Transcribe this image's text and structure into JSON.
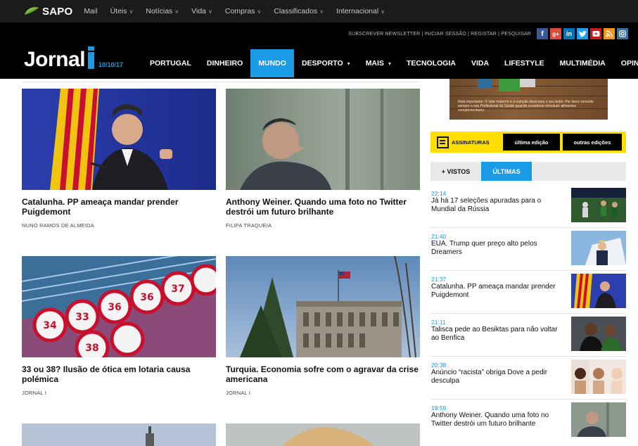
{
  "sapo_bar": {
    "logo": "SAPO",
    "links": [
      "Mail",
      "Úteis",
      "Notícias",
      "Vida",
      "Compras",
      "Classificados",
      "Internacional"
    ],
    "dropdown_links": [
      false,
      true,
      true,
      true,
      true,
      true,
      true
    ]
  },
  "header": {
    "util_links": "SUBSCREVER NEWSLETTER | INICIAR SESSÃO | REGISTAR | PESQUISAR",
    "logo_word": "Jornal",
    "date": "10/10/17",
    "social": [
      {
        "name": "facebook-icon",
        "glyph": "f",
        "color": "#3b5998"
      },
      {
        "name": "google-plus-icon",
        "glyph": "g+",
        "color": "#dd4b39"
      },
      {
        "name": "linkedin-icon",
        "glyph": "in",
        "color": "#0077b5"
      },
      {
        "name": "twitter-icon",
        "glyph": "t",
        "color": "#1da1f2"
      },
      {
        "name": "youtube-icon",
        "glyph": "▶",
        "color": "#cc181e"
      },
      {
        "name": "rss-icon",
        "glyph": "◉",
        "color": "#f7941d"
      },
      {
        "name": "instagram-icon",
        "glyph": "◎",
        "color": "#3f729b"
      }
    ]
  },
  "nav": {
    "items": [
      "PORTUGAL",
      "DINHEIRO",
      "MUNDO",
      "DESPORTO",
      "MAIS",
      "TECNOLOGIA",
      "VIDA",
      "LIFESTYLE",
      "MULTIMÉDIA",
      "OPINIÃO"
    ],
    "active_index": 2,
    "dropdown_items": [
      3,
      4
    ]
  },
  "articles": [
    {
      "title": "Catalunha. PP ameaça mandar prender Puigdemont",
      "author": "NUNO RAMOS DE ALMEIDA"
    },
    {
      "title": "Anthony Weiner. Quando uma foto no Twitter destrói um futuro brilhante",
      "author": "FILIPA TRAQUEIA"
    },
    {
      "title": "33 ou 38? Ilusão de ótica em lotaria causa polémica",
      "author": "JORNAL I"
    },
    {
      "title": "Turquia. Economia sofre com o agravar da crise americana",
      "author": "JORNAL I"
    }
  ],
  "ad": {
    "text": "Nota importante: O leite materno é a nutrição ideal para o seu bebé. Por favor consulte sempre o seu Profissional de Saúde quando considerar introduzir alimentos complementares."
  },
  "subscriptions": {
    "label": "ASSINATURAS",
    "buttons": [
      "última edição",
      "outras edições"
    ]
  },
  "tabs": {
    "items": [
      "+ VISTOS",
      "ÚLTIMAS"
    ],
    "active_index": 1
  },
  "latest": [
    {
      "time": "22:14",
      "headline": "Já há 17 seleções apuradas para o Mundial da Rússia"
    },
    {
      "time": "21:40",
      "headline": "EUA. Trump quer preço alto pelos Dreamers"
    },
    {
      "time": "21:37",
      "headline": "Catalunha. PP ameaça mandar prender Puigdemont"
    },
    {
      "time": "21:11",
      "headline": "Talisca pede ao Besiktas para não voltar ao Benfica"
    },
    {
      "time": "20:38",
      "headline": "Anúncio “racista” obriga Dove a pedir desculpa"
    },
    {
      "time": "19:59",
      "headline": "Anthony Weiner. Quando uma foto no Twitter destrói um futuro brilhante"
    }
  ],
  "colors": {
    "accent": "#1a9be6",
    "subs_yellow": "#ffde00",
    "header_bg": "#000000",
    "sapo_green": "#7ac143"
  }
}
